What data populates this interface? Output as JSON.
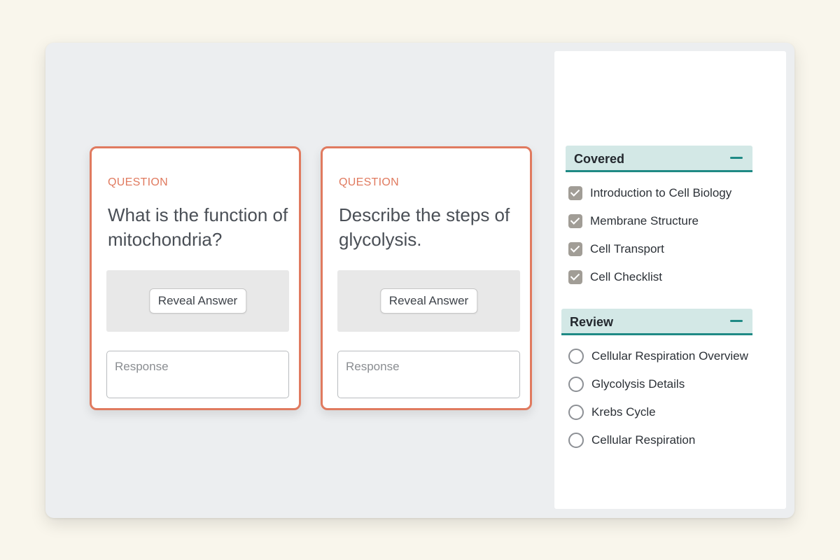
{
  "cards": [
    {
      "label": "QUESTION",
      "question": "What is the function of mitochondria?",
      "reveal_label": "Reveal Answer",
      "response_placeholder": "Response",
      "response_value": ""
    },
    {
      "label": "QUESTION",
      "question": "Describe the steps of glycolysis.",
      "reveal_label": "Reveal Answer",
      "response_placeholder": "Response",
      "response_value": ""
    }
  ],
  "sidebar": {
    "covered": {
      "title": "Covered",
      "icon": "minus-icon",
      "items": [
        {
          "label": "Introduction to Cell Biology",
          "checked": true
        },
        {
          "label": "Membrane Structure",
          "checked": true
        },
        {
          "label": "Cell Transport",
          "checked": true
        },
        {
          "label": "Cell Checklist",
          "checked": true
        }
      ]
    },
    "review": {
      "title": "Review",
      "icon": "minus-icon",
      "items": [
        {
          "label": "Cellular Respiration Overview",
          "selected": false
        },
        {
          "label": "Glycolysis Details",
          "selected": false
        },
        {
          "label": "Krebs Cycle",
          "selected": false
        },
        {
          "label": "Cellular Respiration",
          "selected": false
        }
      ]
    }
  },
  "colors": {
    "card_border": "#e07a5f",
    "accent_teal": "#1f8a85",
    "section_header_bg": "#d3e8e6",
    "checkbox_fill": "#a19d96",
    "page_bg": "#f9f6ec",
    "window_bg": "#eceef0"
  }
}
